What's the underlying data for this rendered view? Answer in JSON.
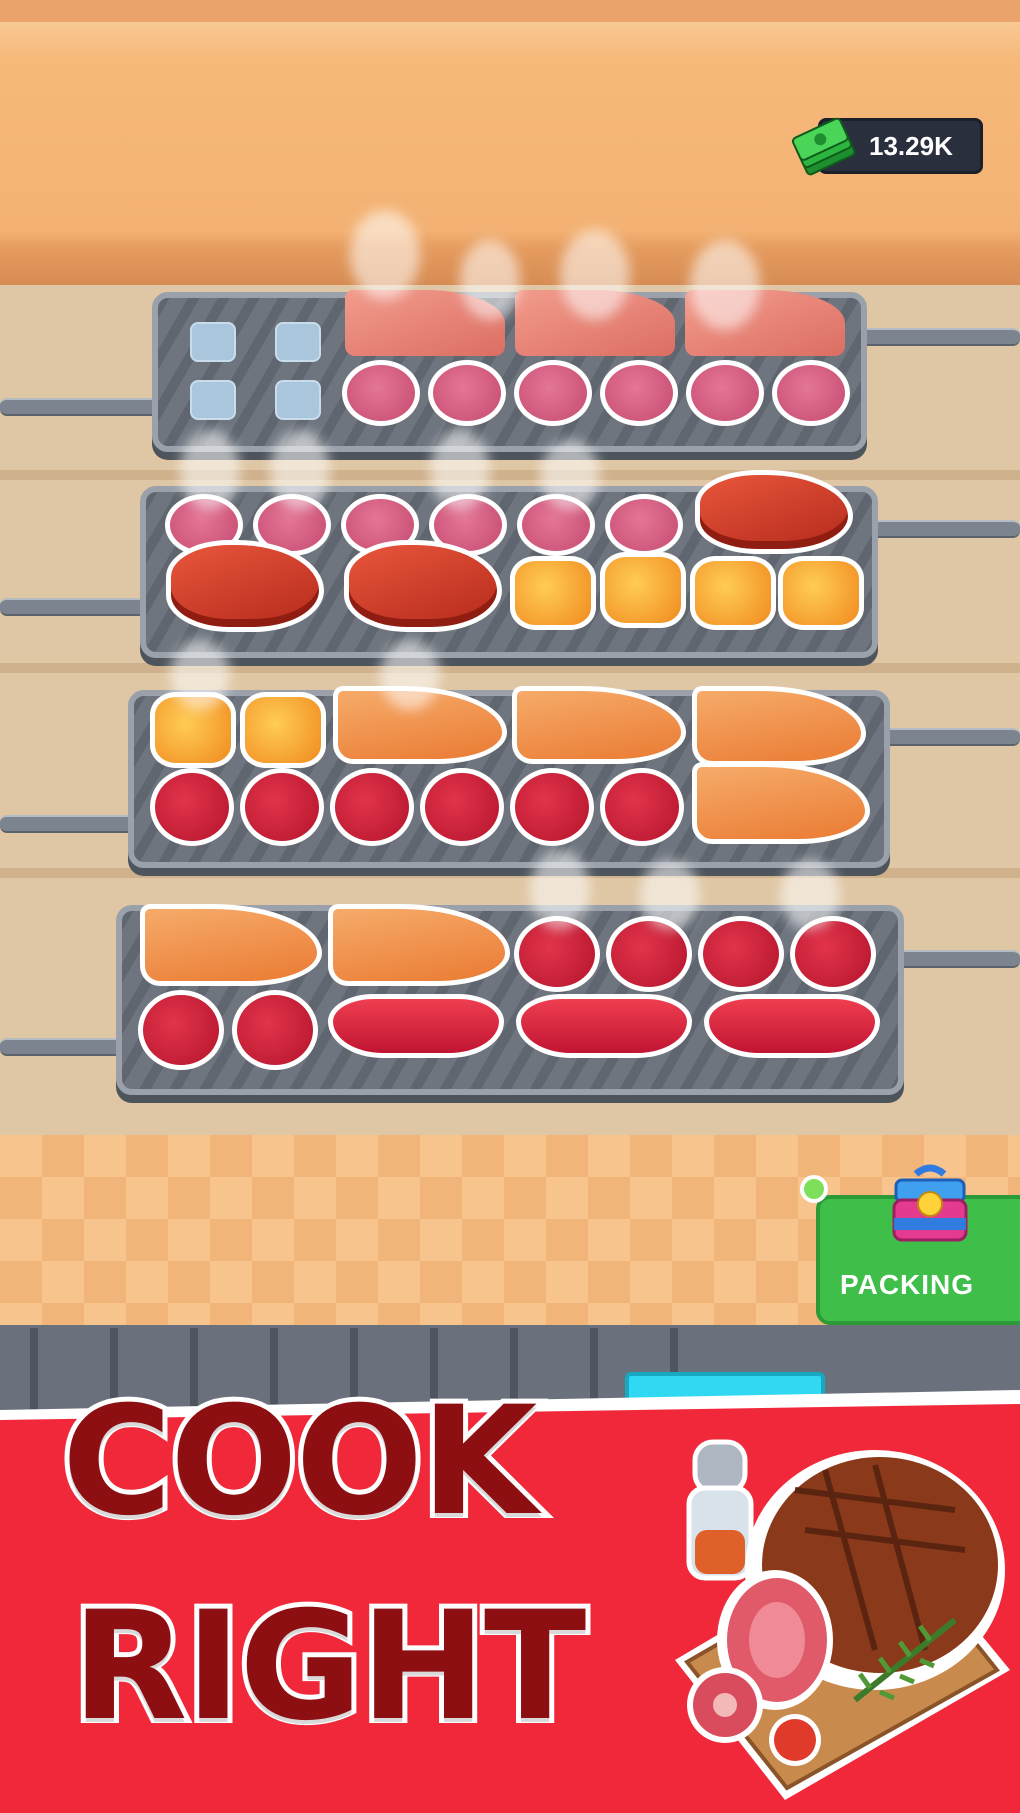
{
  "hud": {
    "money": "13.29K",
    "cash_icon": "cash-stack-icon"
  },
  "grills": [
    {
      "row": 1,
      "items": [
        "ice",
        "ice",
        "ice",
        "ice",
        "bacon",
        "bacon",
        "bacon",
        "salami",
        "salami",
        "salami",
        "salami",
        "salami",
        "salami"
      ]
    },
    {
      "row": 2,
      "items": [
        "salami",
        "salami",
        "salami",
        "salami",
        "salami",
        "salami",
        "steak",
        "steak",
        "steak",
        "nugget",
        "nugget",
        "nugget",
        "nugget"
      ]
    },
    {
      "row": 3,
      "items": [
        "nugget",
        "nugget",
        "fillet",
        "fillet",
        "fillet",
        "meat-round",
        "meat-round",
        "meat-round",
        "meat-round",
        "meat-round",
        "meat-round",
        "fillet"
      ]
    },
    {
      "row": 4,
      "items": [
        "fillet",
        "fillet",
        "meat-round",
        "meat-round",
        "meat-round",
        "meat-round",
        "meat-round",
        "meat-round",
        "sausage",
        "sausage",
        "sausage"
      ]
    }
  ],
  "packing": {
    "label": "PACKING",
    "icon": "lunchbox-icon"
  },
  "banner": {
    "line1": "COOK",
    "line2": "RIGHT"
  },
  "colors": {
    "banner_red": "#f0283a",
    "title_text": "#8e0f12",
    "packing_green": "#3fbf49"
  }
}
